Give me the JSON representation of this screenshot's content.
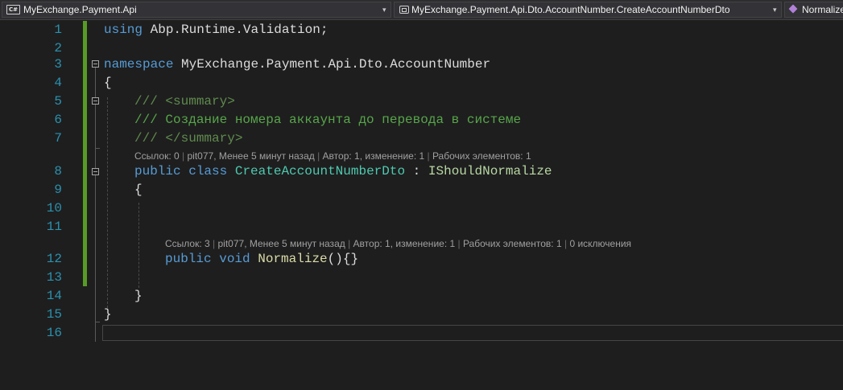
{
  "navbar": {
    "project": "MyExchange.Payment.Api",
    "type": "MyExchange.Payment.Api.Dto.AccountNumber.CreateAccountNumberDto",
    "member": "Normalize",
    "project_icon": "csharp-project-icon",
    "type_icon": "class-icon",
    "member_icon": "method-icon"
  },
  "editor": {
    "line_numbers": [
      "1",
      "2",
      "3",
      "4",
      "5",
      "6",
      "7",
      "8",
      "9",
      "10",
      "11",
      "12",
      "13",
      "14",
      "15",
      "16"
    ],
    "code": {
      "l1_using": "using",
      "l1_ns": " Abp.Runtime.Validation;",
      "l3_kw": "namespace",
      "l3_name": " MyExchange.Payment.Api.Dto.AccountNumber",
      "l4": "{",
      "l5_slashes": "/// ",
      "l5_tag": "<summary>",
      "l6": "/// Создание номера аккаунта до перевода в системе",
      "l7_slashes": "/// ",
      "l7_tag": "</summary>",
      "l8_public": "public",
      "l8_class": "class",
      "l8_name": "CreateAccountNumberDto",
      "l8_colon": " : ",
      "l8_iface": "IShouldNormalize",
      "l9": "{",
      "l12_public": "public",
      "l12_void": "void",
      "l12_method": "Normalize",
      "l12_rest": "(){}",
      "l14": "}",
      "l15": "}"
    },
    "codelens_class": {
      "refs": "Ссылок: 0",
      "author": "pit077, Менее 5 минут назад",
      "changes": "Автор: 1, изменение: 1",
      "work_items": "Рабочих элементов: 1"
    },
    "codelens_method": {
      "refs": "Ссылок: 3",
      "author": "pit077, Менее 5 минут назад",
      "changes": "Автор: 1, изменение: 1",
      "work_items": "Рабочих элементов: 1",
      "exceptions": "0 исключения"
    }
  },
  "colors": {
    "background": "#1e1e1e",
    "keyword": "#569cd6",
    "type": "#4ec9b0",
    "interface": "#b8d7a3",
    "method": "#dcdcaa",
    "comment": "#57a64a",
    "line_number": "#2b91af",
    "change_bar": "#579b25"
  }
}
